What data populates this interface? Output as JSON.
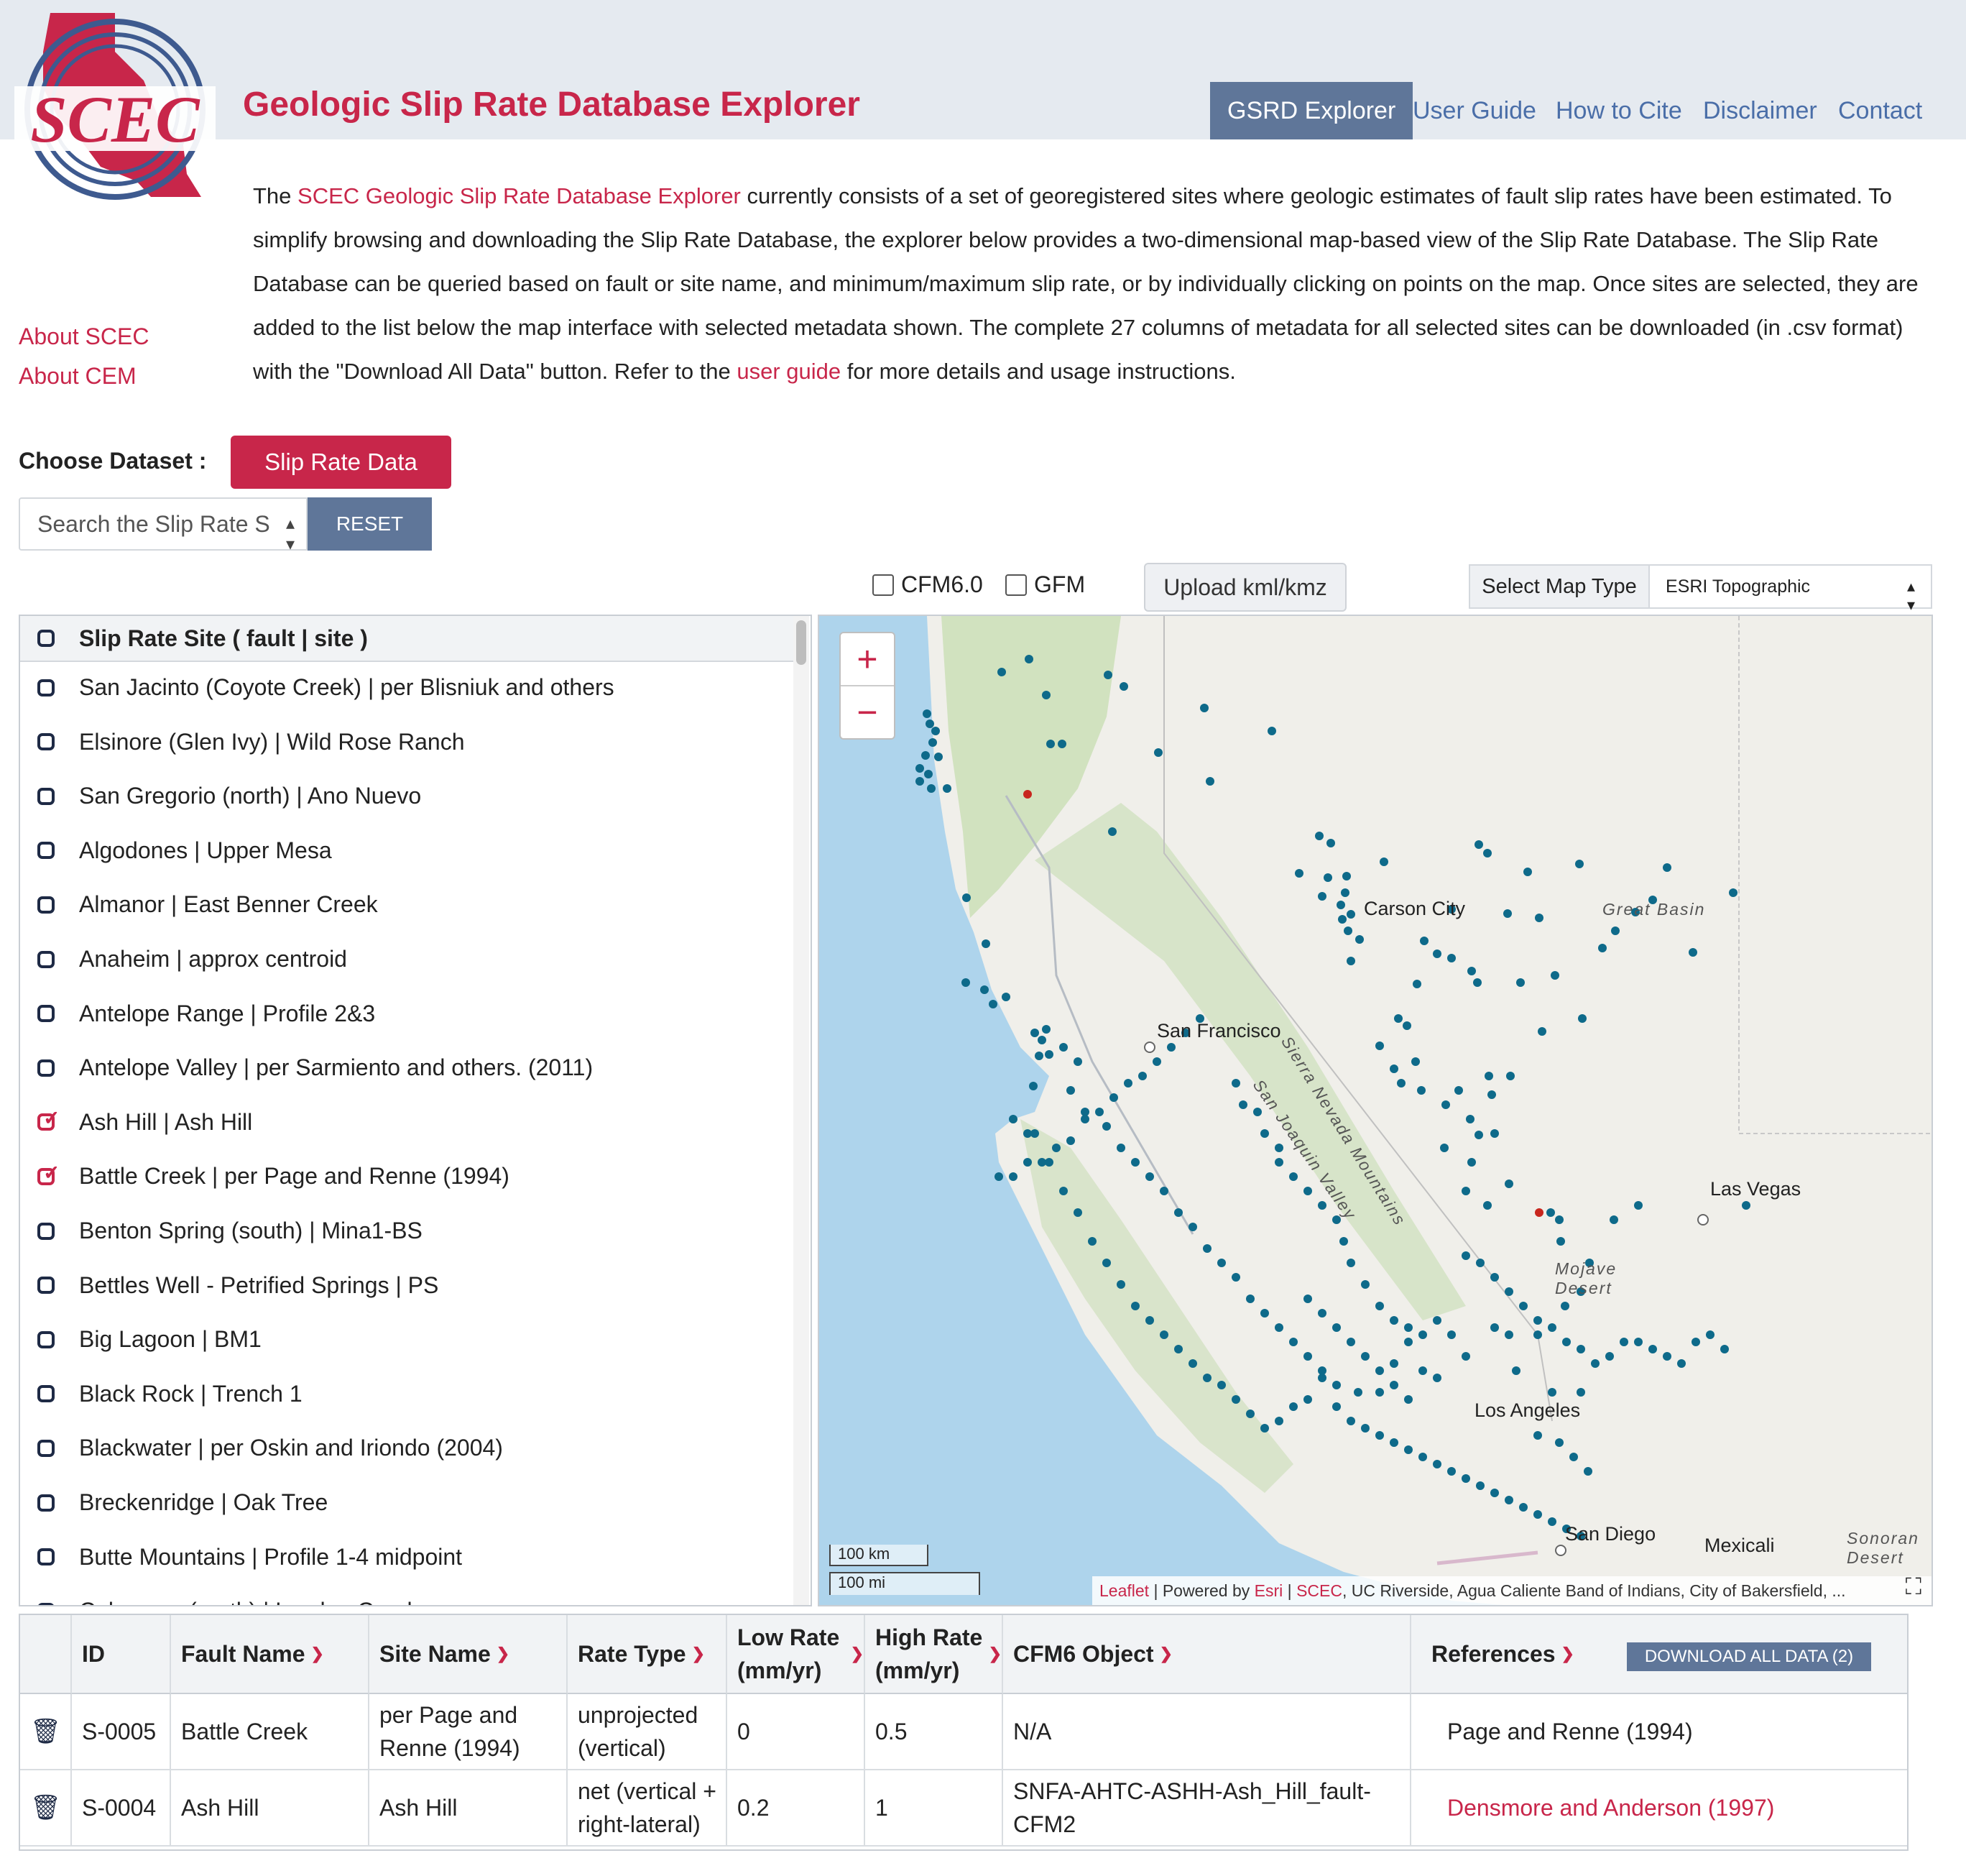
{
  "header": {
    "logo_text": "SCEC",
    "title": "Geologic Slip Rate Database Explorer",
    "nav": [
      "GSRD Explorer",
      "User Guide",
      "How to Cite",
      "Disclaimer",
      "Contact"
    ],
    "active_nav": "GSRD Explorer"
  },
  "sidebar_links": [
    "About SCEC",
    "About CEM"
  ],
  "intro": {
    "p1": "The ",
    "link1": "SCEC Geologic Slip Rate Database Explorer",
    "p2": " currently consists of a set of georegistered sites where geologic estimates of fault slip rates have been estimated. To simplify browsing and downloading the Slip Rate Database, the explorer below provides a two-dimensional map-based view of the Slip Rate Database. The Slip Rate Database can be queried based on fault or site name, and minimum/maximum slip rate, or by individually clicking on points on the map. Once sites are selected, they are added to the list below the map interface with selected metadata shown. The complete 27 columns of metadata for all selected sites can be downloaded (in .csv format) with the \"Download All Data\" button. Refer to the ",
    "link2": "user guide",
    "p3": " for more details and usage instructions."
  },
  "dataset": {
    "label": "Choose Dataset :",
    "button": "Slip Rate Data"
  },
  "search": {
    "text": "Search the Slip Rate S",
    "reset": "RESET"
  },
  "toolbar": {
    "cfm": "CFM6.0",
    "gfm": "GFM",
    "upload": "Upload kml/kmz",
    "maptype_label": "Select Map Type",
    "maptype_value": "ESRI Topographic"
  },
  "site_list": {
    "header": "Slip Rate Site ( fault | site )",
    "items": [
      {
        "label": "San Jacinto (Coyote Creek) | per Blisniuk and others",
        "checked": false
      },
      {
        "label": "Elsinore (Glen Ivy) | Wild Rose Ranch",
        "checked": false
      },
      {
        "label": "San Gregorio (north) | Ano Nuevo",
        "checked": false
      },
      {
        "label": "Algodones | Upper Mesa",
        "checked": false
      },
      {
        "label": "Almanor | East Benner Creek",
        "checked": false
      },
      {
        "label": "Anaheim | approx centroid",
        "checked": false
      },
      {
        "label": "Antelope Range | Profile 2&3",
        "checked": false
      },
      {
        "label": "Antelope Valley | per Sarmiento and others. (2011)",
        "checked": false
      },
      {
        "label": "Ash Hill | Ash Hill",
        "checked": true
      },
      {
        "label": "Battle Creek | per Page and Renne (1994)",
        "checked": true
      },
      {
        "label": "Benton Spring (south) | Mina1-BS",
        "checked": false
      },
      {
        "label": "Bettles Well - Petrified Springs | PS",
        "checked": false
      },
      {
        "label": "Big Lagoon | BM1",
        "checked": false
      },
      {
        "label": "Black Rock | Trench 1",
        "checked": false
      },
      {
        "label": "Blackwater | per Oskin and Iriondo (2004)",
        "checked": false
      },
      {
        "label": "Breckenridge | Oak Tree",
        "checked": false
      },
      {
        "label": "Butte Mountains | Profile 1-4 midpoint",
        "checked": false
      },
      {
        "label": "Calaveras (north) | Leyden Creek",
        "checked": false
      }
    ]
  },
  "map": {
    "cities": [
      "Carson City",
      "San Francisco",
      "Las Vegas",
      "Los Angeles",
      "San Diego",
      "Mexicali"
    ],
    "regions": [
      "Great Basin",
      "Sierra Nevada Mountains",
      "San Joaquin Valley",
      "Mojave Desert",
      "Sonoran Desert"
    ],
    "scale_km": "100 km",
    "scale_mi": "100 mi",
    "attribution": {
      "leaflet": "Leaflet",
      "sep1": " | Powered by ",
      "esri": "Esri",
      "sep2": " | ",
      "scec": "SCEC",
      "rest": ", UC Riverside, Agua Caliente Band of Indians, City of Bakersfield, ..."
    },
    "colors": {
      "water": "#aed4ec",
      "land": "#f0efea",
      "site": "#0e6a8a",
      "selected_site": "#c8261e"
    }
  },
  "table": {
    "columns": [
      "ID",
      "Fault Name",
      "Site Name",
      "Rate Type",
      "Low Rate (mm/yr)",
      "High Rate (mm/yr)",
      "CFM6 Object",
      "References"
    ],
    "download_button": "DOWNLOAD ALL DATA (2)",
    "rows": [
      {
        "id": "S-0005",
        "fault": "Battle Creek",
        "site": "per Page and Renne (1994)",
        "rate_type": "unprojected (vertical)",
        "low": "0",
        "high": "0.5",
        "cfm6": "N/A",
        "reference": "Page and Renne (1994)",
        "reference_link": false
      },
      {
        "id": "S-0004",
        "fault": "Ash Hill",
        "site": "Ash Hill",
        "rate_type": "net (vertical + right-lateral)",
        "low": "0.2",
        "high": "1",
        "cfm6": "SNFA-AHTC-ASHH-Ash_Hill_fault-CFM2",
        "reference": "Densmore and Anderson (1997)",
        "reference_link": true
      }
    ]
  },
  "colors": {
    "brand": "#c8264a",
    "nav_active": "#5f7699",
    "header_bg": "#e5eaf0"
  }
}
